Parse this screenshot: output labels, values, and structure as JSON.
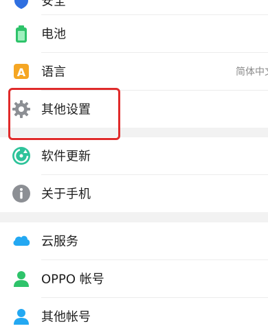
{
  "settings": {
    "items": [
      {
        "label": "安全",
        "icon": "shield-icon"
      },
      {
        "label": "电池",
        "icon": "battery-icon"
      },
      {
        "label": "语言",
        "icon": "language-icon",
        "value": "简体中文"
      },
      {
        "label": "其他设置",
        "icon": "gear-icon"
      },
      {
        "label": "软件更新",
        "icon": "update-icon"
      },
      {
        "label": "关于手机",
        "icon": "info-icon"
      },
      {
        "label": "云服务",
        "icon": "cloud-icon"
      },
      {
        "label": "OPPO 帐号",
        "icon": "account-icon"
      },
      {
        "label": "其他帐号",
        "icon": "account-icon"
      }
    ]
  },
  "colors": {
    "highlight": "#e02a2a",
    "divider_band": "#f2f2f2",
    "shield": "#2f6fe0",
    "battery": "#2ec36a",
    "language": "#f5a623",
    "gear": "#8c8f94",
    "update": "#2ec39a",
    "info": "#8c8f94",
    "cloud": "#23a8f2",
    "account": "#2ec36a"
  }
}
